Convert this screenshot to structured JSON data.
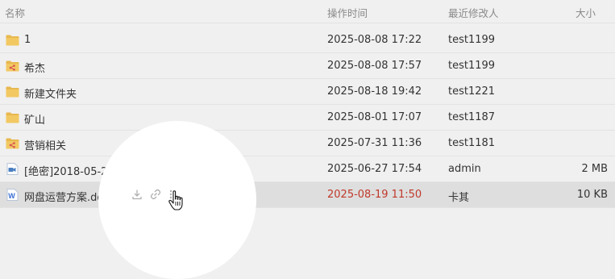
{
  "columns": {
    "name": "名称",
    "time": "操作时间",
    "user": "最近修改人",
    "size": "大小"
  },
  "rows": [
    {
      "icon": "folder-icon",
      "name": "1",
      "time": "2025-08-08 17:22",
      "user": "test1199",
      "size": ""
    },
    {
      "icon": "shared-folder-icon",
      "name": "希杰",
      "time": "2025-08-08 17:57",
      "user": "test1199",
      "size": ""
    },
    {
      "icon": "folder-icon",
      "name": "新建文件夹",
      "time": "2025-08-18 19:42",
      "user": "test1221",
      "size": ""
    },
    {
      "icon": "folder-icon",
      "name": "矿山",
      "time": "2025-08-01 17:07",
      "user": "test1187",
      "size": ""
    },
    {
      "icon": "shared-folder-icon",
      "name": "营销相关",
      "time": "2025-07-31 11:36",
      "user": "test1181",
      "size": ""
    },
    {
      "icon": "video-file-icon",
      "name": "[绝密]2018-05-20 131607.mp4",
      "time": "2025-06-27 17:54",
      "user": "admin",
      "size": "2 MB"
    },
    {
      "icon": "word-file-icon",
      "name": "网盘运营方案.docx",
      "time": "2025-08-19 11:50",
      "user": "卡其",
      "size": "10 KB"
    }
  ],
  "row_actions": [
    "download-icon",
    "link-icon",
    "more-icon"
  ],
  "colors": {
    "folder": "#e8b84e",
    "shared_badge": "#d9534f",
    "video": "#4a7fc1",
    "word": "#3b6fd3",
    "highlight_time": "#c0392b"
  }
}
